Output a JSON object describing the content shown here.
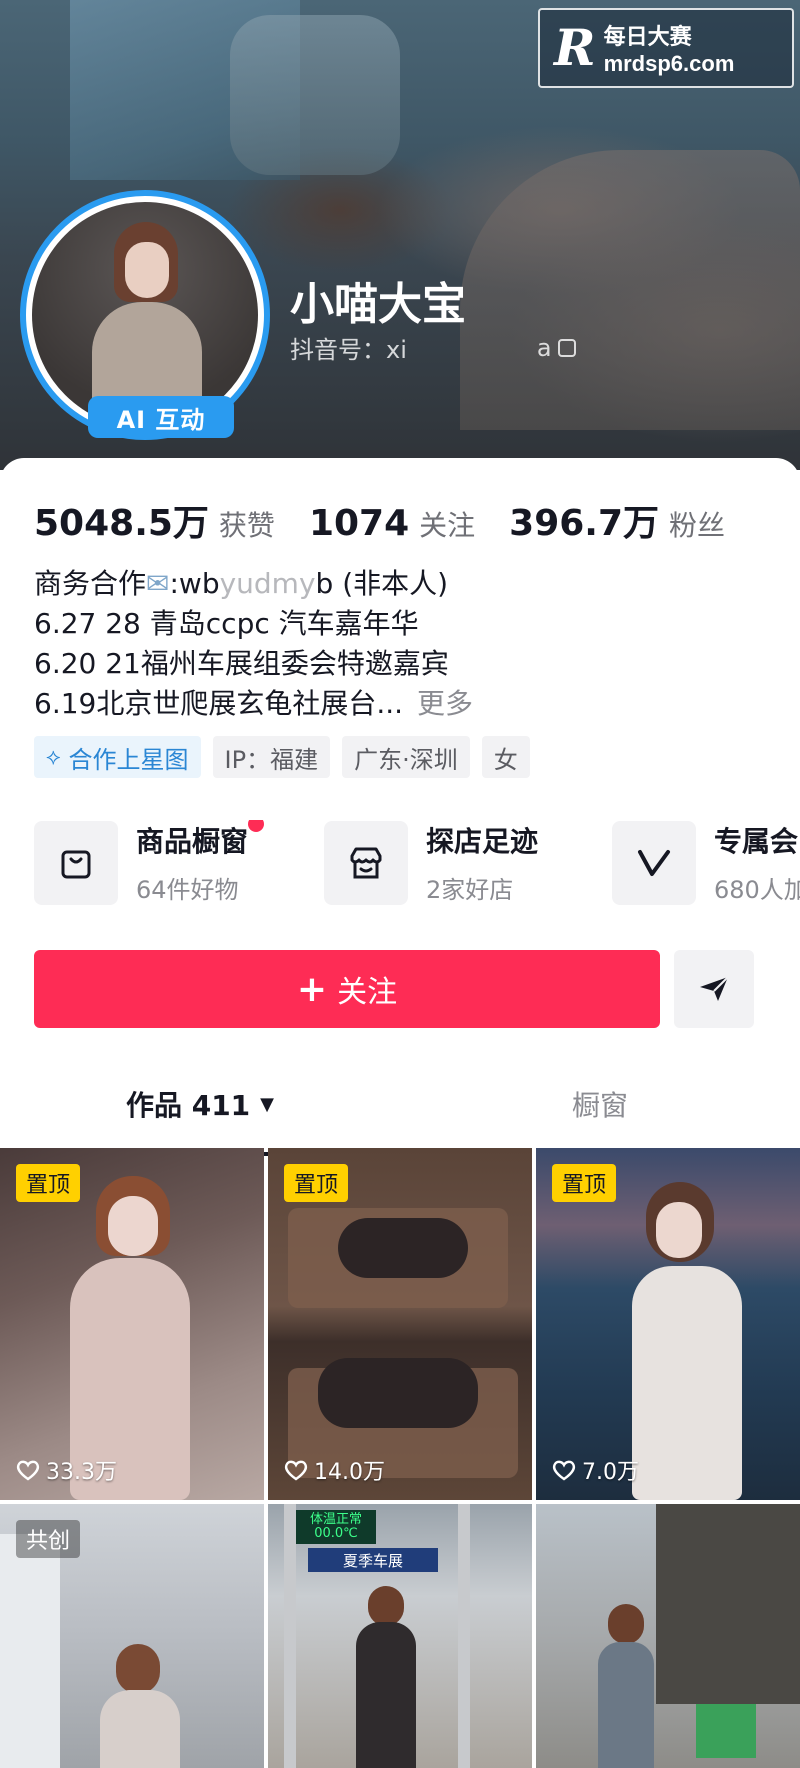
{
  "watermark": {
    "logo": "R",
    "line1": "每日大赛",
    "line2": "mrdsp6.com"
  },
  "profile": {
    "nickname": "小喵大宝",
    "douyin_id_prefix": "抖音号：xi",
    "douyin_id_suffix": "a",
    "ai_badge": "AI 互动"
  },
  "stats": [
    {
      "value": "5048.5万",
      "label": "获赞"
    },
    {
      "value": "1074",
      "label": "关注"
    },
    {
      "value": "396.7万",
      "label": "粉丝"
    }
  ],
  "bio": {
    "line1_prefix": "商务合作",
    "line1_contact": ":wb",
    "line1_blur": "yudmy",
    "line1_suffix": "b (非本人)",
    "line2": "6.27 28 青岛ccpc 汽车嘉年华",
    "line3": "6.20 21福州车展组委会特邀嘉宾",
    "line4": "6.19北京世爬展玄龟社展台...",
    "more": "更多"
  },
  "tags": [
    {
      "label": "合作上星图",
      "icon": "star-map-icon"
    },
    {
      "label": "IP：福建"
    },
    {
      "label": "广东·深圳"
    },
    {
      "label": "女"
    }
  ],
  "services": [
    {
      "title": "商品橱窗",
      "sub": "64件好物",
      "icon": "shopping-bag-icon"
    },
    {
      "title": "探店足迹",
      "sub": "2家好店",
      "icon": "store-icon"
    },
    {
      "title": "专属会",
      "sub": "680人加",
      "icon": "v-badge-icon"
    }
  ],
  "actions": {
    "follow": "关注",
    "share_icon": "share-arrow-icon"
  },
  "tabs": {
    "works": "作品 411",
    "showcase": "橱窗"
  },
  "videos": [
    {
      "badge": "置顶",
      "likes": "33.3万"
    },
    {
      "badge": "置顶",
      "likes": "14.0万"
    },
    {
      "badge": "置顶",
      "likes": "7.0万"
    },
    {
      "badge": "共创",
      "likes": ""
    },
    {
      "badge": "",
      "likes": "",
      "sign_a": "体温正常",
      "sign_b": "00.0℃",
      "banner": "夏季车展"
    },
    {
      "badge": "",
      "likes": ""
    }
  ],
  "colors": {
    "accent": "#fe2c55",
    "ring": "#2a9bf0",
    "pin": "#ffd000"
  }
}
